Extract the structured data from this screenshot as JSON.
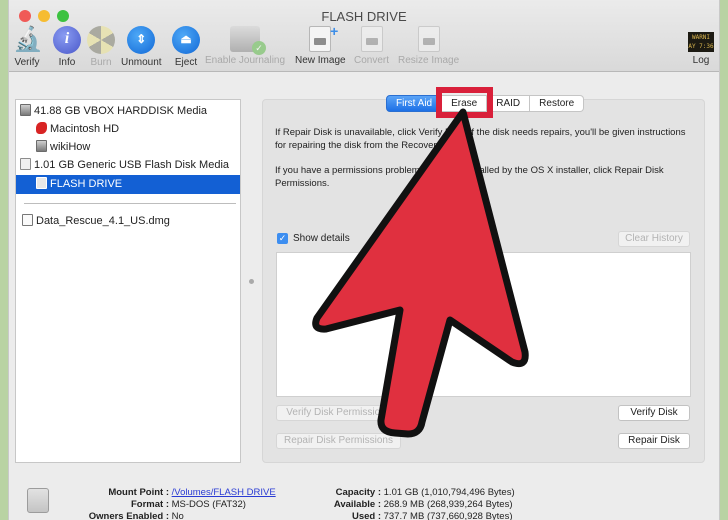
{
  "window": {
    "title": "FLASH DRIVE",
    "controls": [
      "close",
      "minimize",
      "zoom"
    ]
  },
  "toolbar": {
    "items": [
      {
        "label": "Verify",
        "icon": "microscope-icon",
        "enabled": true
      },
      {
        "label": "Info",
        "icon": "info-icon",
        "enabled": true
      },
      {
        "label": "Burn",
        "icon": "burn-icon",
        "enabled": false
      },
      {
        "label": "Unmount",
        "icon": "unmount-icon",
        "enabled": true
      },
      {
        "label": "Eject",
        "icon": "eject-icon",
        "enabled": true
      },
      {
        "label": "Enable Journaling",
        "icon": "journaling-icon",
        "enabled": false
      },
      {
        "label": "New Image",
        "icon": "new-image-icon",
        "enabled": true
      },
      {
        "label": "Convert",
        "icon": "convert-icon",
        "enabled": false
      },
      {
        "label": "Resize Image",
        "icon": "resize-image-icon",
        "enabled": false
      },
      {
        "label": "Log",
        "icon": "log-icon",
        "enabled": true
      }
    ],
    "log_icon_text": "WARNI\nAY 7:36"
  },
  "sidebar": {
    "items": [
      {
        "label": "41.88 GB VBOX HARDDISK Media",
        "icon": "hard-disk-icon",
        "level": 0,
        "selected": false
      },
      {
        "label": "Macintosh HD",
        "icon": "macintosh-hd-icon",
        "level": 1,
        "selected": false
      },
      {
        "label": "wikiHow",
        "icon": "volume-icon",
        "level": 1,
        "selected": false
      },
      {
        "label": "1.01 GB Generic USB Flash Disk Media",
        "icon": "usb-disk-icon",
        "level": 0,
        "selected": false
      },
      {
        "label": "FLASH DRIVE",
        "icon": "usb-volume-icon",
        "level": 1,
        "selected": true
      }
    ],
    "images": [
      {
        "label": "Data_Rescue_4.1_US.dmg",
        "icon": "dmg-icon"
      }
    ]
  },
  "tabs": [
    {
      "label": "First Aid",
      "active": true
    },
    {
      "label": "Erase",
      "active": false,
      "highlighted": true
    },
    {
      "label": "RAID",
      "active": false
    },
    {
      "label": "Restore",
      "active": false
    }
  ],
  "first_aid": {
    "paragraph1": "If Repair Disk is unavailable, click Verify Disk. If the disk needs repairs, you'll be given instructions for repairing the disk from the Recovery HD.",
    "paragraph2": "If you have a permissions problem with a file installed by the OS X installer, click Repair Disk Permissions.",
    "show_details_label": "Show details",
    "show_details_checked": true,
    "clear_history_label": "Clear History",
    "verify_permissions_label": "Verify Disk Permissions",
    "repair_permissions_label": "Repair Disk Permissions",
    "verify_disk_label": "Verify Disk",
    "repair_disk_label": "Repair Disk"
  },
  "info": {
    "left": [
      {
        "key": "Mount Point :",
        "value": "/Volumes/FLASH DRIVE",
        "link": true
      },
      {
        "key": "Format :",
        "value": "MS-DOS (FAT32)",
        "link": false
      },
      {
        "key": "Owners Enabled :",
        "value": "No",
        "link": false
      }
    ],
    "right": [
      {
        "key": "Capacity :",
        "value": "1.01 GB (1,010,794,496 Bytes)"
      },
      {
        "key": "Available :",
        "value": "268.9 MB (268,939,264 Bytes)"
      },
      {
        "key": "Used :",
        "value": "737.7 MB (737,660,928 Bytes)"
      }
    ]
  },
  "annotation": {
    "type": "pointer-arrow",
    "target": "Erase",
    "color": "#e0303f",
    "outline_color": "#111111",
    "highlight_color": "#d9203a"
  }
}
